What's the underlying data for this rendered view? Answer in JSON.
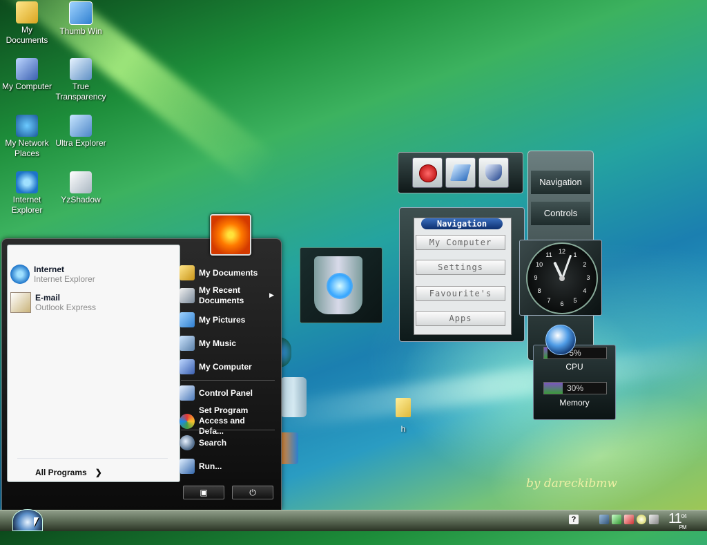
{
  "desktop": {
    "icons": [
      {
        "label": "My Documents"
      },
      {
        "label": "Thumb Win"
      },
      {
        "label": "My Computer"
      },
      {
        "label": "True Transparency"
      },
      {
        "label": "My Network Places"
      },
      {
        "label": "Ultra Explorer"
      },
      {
        "label": "Internet Explorer"
      },
      {
        "label": "YzShadow"
      }
    ],
    "folder_label": "h",
    "signature": "by dareckibmw"
  },
  "start_menu": {
    "pinned": [
      {
        "title": "Internet",
        "subtitle": "Internet Explorer"
      },
      {
        "title": "E-mail",
        "subtitle": "Outlook Express"
      }
    ],
    "all_programs": "All Programs",
    "right_items": {
      "my_documents": "My Documents",
      "my_recent_documents": "My Recent Documents",
      "my_pictures": "My Pictures",
      "my_music": "My Music",
      "my_computer": "My Computer",
      "control_panel": "Control Panel",
      "set_program_access": "Set Program Access and Defa...",
      "search": "Search",
      "run": "Run..."
    }
  },
  "nav_widget": {
    "title": "Navigation",
    "buttons": [
      "My Computer",
      "Settings",
      "Favourite's",
      "Apps"
    ]
  },
  "side_panel": {
    "buttons": [
      "Navigation",
      "Controls"
    ]
  },
  "clock_widget": {
    "numbers": [
      "12",
      "1",
      "2",
      "3",
      "4",
      "5",
      "6",
      "7",
      "8",
      "9",
      "10",
      "11"
    ]
  },
  "meter_widget": {
    "cpu_label": "CPU",
    "cpu_value": "5%",
    "cpu_fraction": 0.05,
    "memory_label": "Memory",
    "memory_value": "30%",
    "memory_fraction": 0.3
  },
  "taskbar": {
    "time_hour": "11",
    "time_minute": "04",
    "time_ampm": "PM",
    "help_label": "?"
  }
}
